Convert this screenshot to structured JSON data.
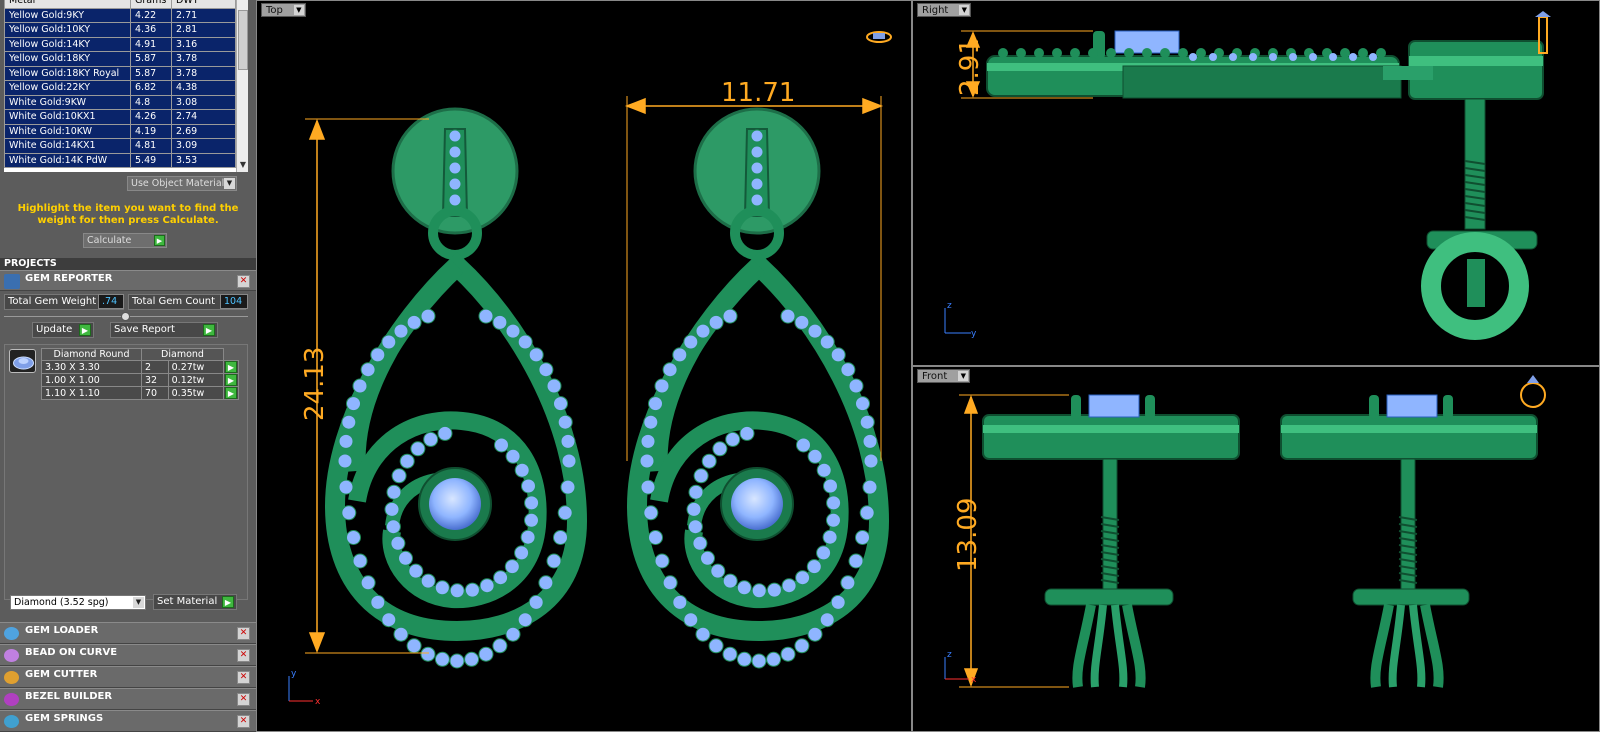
{
  "metals": {
    "headers": [
      "Metal",
      "Grams",
      "DWT"
    ],
    "rows": [
      [
        "Yellow Gold:9KY",
        "4.22",
        "2.71"
      ],
      [
        "Yellow Gold:10KY",
        "4.36",
        "2.81"
      ],
      [
        "Yellow Gold:14KY",
        "4.91",
        "3.16"
      ],
      [
        "Yellow Gold:18KY",
        "5.87",
        "3.78"
      ],
      [
        "Yellow Gold:18KY Royal",
        "5.87",
        "3.78"
      ],
      [
        "Yellow Gold:22KY",
        "6.82",
        "4.38"
      ],
      [
        "White Gold:9KW",
        "4.8",
        "3.08"
      ],
      [
        "White Gold:10KX1",
        "4.26",
        "2.74"
      ],
      [
        "White Gold:10KW",
        "4.19",
        "2.69"
      ],
      [
        "White Gold:14KX1",
        "4.81",
        "3.09"
      ],
      [
        "White Gold:14K PdW",
        "5.49",
        "3.53"
      ]
    ]
  },
  "object_materials_dropdown": "Use Object Materials",
  "hint_text": "Highlight the item you want to find the weight for then press Calculate.",
  "calculate_dropdown": "Calculate",
  "projects_label": "PROJECTS",
  "gem_reporter": {
    "title": "GEM REPORTER",
    "total_weight_label": "Total Gem Weight",
    "total_weight_value": ".74",
    "total_count_label": "Total Gem Count",
    "total_count_value": "104",
    "update_label": "Update",
    "save_report_label": "Save Report",
    "table_headers": [
      "Diamond Round",
      "Diamond"
    ],
    "rows": [
      [
        "3.30 X 3.30",
        "2",
        "0.27tw"
      ],
      [
        "1.00 X 1.00",
        "32",
        "0.12tw"
      ],
      [
        "1.10 X 1.10",
        "70",
        "0.35tw"
      ]
    ],
    "material_select": "Diamond   (3.52 spg)",
    "set_material_label": "Set Material"
  },
  "bottom_panels": [
    {
      "title": "GEM LOADER",
      "icon": "gem-loader-icon",
      "color": "#4fa3e0"
    },
    {
      "title": "BEAD ON CURVE",
      "icon": "bead-on-curve-icon",
      "color": "#c080e0"
    },
    {
      "title": "GEM CUTTER",
      "icon": "gem-cutter-icon",
      "color": "#e0a030"
    },
    {
      "title": "BEZEL BUILDER",
      "icon": "bezel-builder-icon",
      "color": "#b040c0"
    },
    {
      "title": "GEM SPRINGS",
      "icon": "gem-springs-icon",
      "color": "#40a0d0"
    }
  ],
  "viewports": {
    "top": {
      "label": "Top",
      "dim_width": "11.71",
      "dim_height": "24.13",
      "axis_y": "y",
      "axis_x": "x"
    },
    "right": {
      "label": "Right",
      "dim_height": "2.91",
      "axis_z": "z",
      "axis_y": "y"
    },
    "front": {
      "label": "Front",
      "dim_height": "13.09",
      "axis_z": "z",
      "axis_x": "x"
    }
  },
  "colors": {
    "metal_green": "#1f8f5a",
    "metal_light": "#3fbf7f",
    "gem_blue": "#8fb5ff",
    "dimension": "#ffaa22",
    "hint": "#ffd000"
  }
}
